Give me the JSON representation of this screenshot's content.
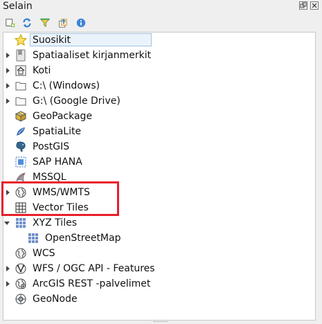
{
  "panel": {
    "title": "Selain"
  },
  "toolbar": {
    "buttons": [
      {
        "name": "add-layer-button",
        "icon": "add-layer-icon"
      },
      {
        "name": "refresh-button",
        "icon": "refresh-icon"
      },
      {
        "name": "filter-button",
        "icon": "filter-icon"
      },
      {
        "name": "collapse-all-button",
        "icon": "collapse-icon"
      },
      {
        "name": "properties-button",
        "icon": "info-icon"
      }
    ]
  },
  "tree": {
    "items": [
      {
        "label": "Suosikit",
        "icon": "star-icon",
        "expander": "none"
      },
      {
        "label": "Spatiaaliset kirjanmerkit",
        "icon": "bookmark-icon",
        "expander": "collapsed"
      },
      {
        "label": "Koti",
        "icon": "home-icon",
        "expander": "collapsed"
      },
      {
        "label": "C:\\ (Windows)",
        "icon": "folder-icon",
        "expander": "collapsed"
      },
      {
        "label": "G:\\ (Google Drive)",
        "icon": "folder-icon",
        "expander": "collapsed"
      },
      {
        "label": "GeoPackage",
        "icon": "geopackage-icon",
        "expander": "none"
      },
      {
        "label": "SpatiaLite",
        "icon": "spatialite-icon",
        "expander": "none"
      },
      {
        "label": "PostGIS",
        "icon": "postgis-icon",
        "expander": "none"
      },
      {
        "label": "SAP HANA",
        "icon": "hana-icon",
        "expander": "none"
      },
      {
        "label": "MSSQL",
        "icon": "mssql-icon",
        "expander": "none"
      },
      {
        "label": "WMS/WMTS",
        "icon": "globe-icon",
        "expander": "collapsed"
      },
      {
        "label": "Vector Tiles",
        "icon": "vector-tiles-icon",
        "expander": "none"
      },
      {
        "label": "XYZ Tiles",
        "icon": "xyz-tiles-icon",
        "expander": "expanded"
      },
      {
        "label": "OpenStreetMap",
        "icon": "xyz-tiles-icon",
        "expander": "child"
      },
      {
        "label": "WCS",
        "icon": "globe-icon",
        "expander": "none"
      },
      {
        "label": "WFS / OGC API - Features",
        "icon": "wfs-icon",
        "expander": "collapsed"
      },
      {
        "label": "ArcGIS REST -palvelimet",
        "icon": "arcgis-icon",
        "expander": "collapsed"
      },
      {
        "label": "GeoNode",
        "icon": "geonode-icon",
        "expander": "none"
      }
    ]
  },
  "colors": {
    "highlight": "#e8202a",
    "selection": "#9fc2e3"
  }
}
